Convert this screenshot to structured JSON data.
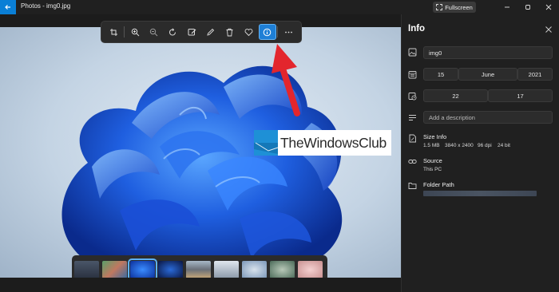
{
  "titlebar": {
    "title": "Photos - img0.jpg",
    "fullscreen_label": "Fullscreen",
    "icons": [
      "back-arrow-icon",
      "fullscreen-icon",
      "minimize-icon",
      "maximize-icon",
      "close-icon"
    ]
  },
  "toolbar": {
    "buttons": [
      "crop-icon",
      "zoom-in-icon",
      "zoom-out-icon",
      "rotate-icon",
      "edit-image-icon",
      "draw-icon",
      "delete-icon",
      "favorite-icon",
      "info-icon",
      "more-options-icon"
    ],
    "active_button": "info-icon"
  },
  "watermark": {
    "text": "TheWindowsClub"
  },
  "filmstrip": {
    "thumbnail_count": 9,
    "selected_index": 2
  },
  "info": {
    "title": "Info",
    "filename": "img0",
    "date": {
      "day": "15",
      "month": "June",
      "year": "2021"
    },
    "time": {
      "hour": "22",
      "minute": "17"
    },
    "description_placeholder": "Add a description",
    "size_info": {
      "label": "Size Info",
      "file_size": "1.5 MB",
      "dimensions": "3840 x 2400",
      "dpi": "96 dpi",
      "bit_depth": "24 bit"
    },
    "source": {
      "label": "Source",
      "value": "This PC"
    },
    "folder_path": {
      "label": "Folder Path"
    }
  },
  "colors": {
    "accent": "#1e7fd6",
    "annotation_arrow": "#e3262d",
    "panel_bg": "#202020"
  }
}
